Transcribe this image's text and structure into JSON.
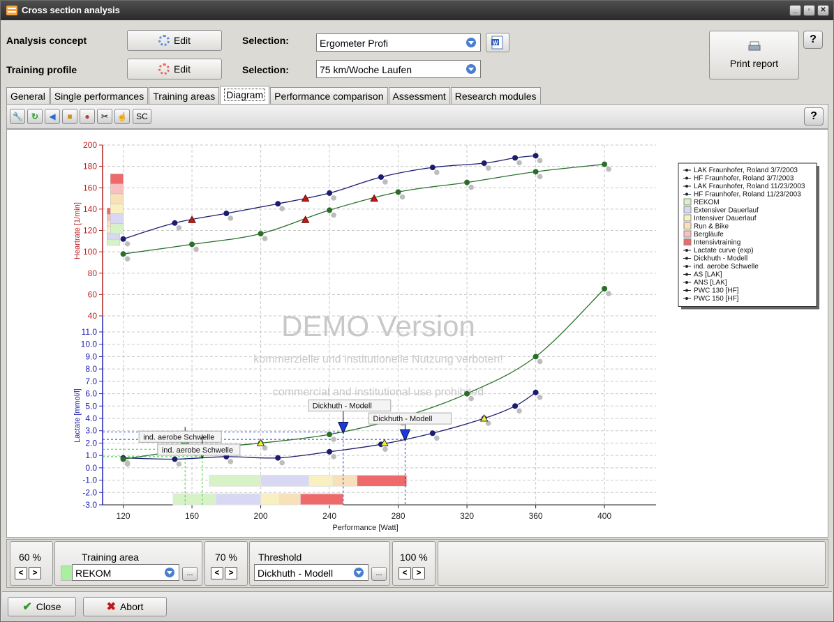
{
  "window": {
    "title": "Cross section analysis"
  },
  "header": {
    "analysis_concept_label": "Analysis concept",
    "training_profile_label": "Training profile",
    "edit_label": "Edit",
    "selection_label": "Selection:",
    "analysis_selection": "Ergometer Profi",
    "training_selection": "75 km/Woche Laufen",
    "print_label": "Print report",
    "help_label": "?"
  },
  "tabs": [
    {
      "label": "General"
    },
    {
      "label": "Single performances"
    },
    {
      "label": "Training areas"
    },
    {
      "label": "Diagram"
    },
    {
      "label": "Performance comparison"
    },
    {
      "label": "Assessment"
    },
    {
      "label": "Research modules"
    }
  ],
  "toolbar": {
    "sc_label": "SC",
    "help_label": "?"
  },
  "chart_data": {
    "type": "line",
    "xlabel": "Performance [Watt]",
    "ylabel_top": "Heartrate [1/min]",
    "ylabel_bottom": "Lactate [mmol/l]",
    "x_ticks": [
      120,
      160,
      200,
      240,
      280,
      320,
      360,
      400
    ],
    "hr_ticks": [
      40,
      60,
      80,
      100,
      120,
      140,
      160,
      180,
      200
    ],
    "lac_ticks": [
      "11.0",
      "10.0",
      "9.0",
      "8.0",
      "7.0",
      "6.0",
      "5.0",
      "4.0",
      "3.0",
      "2.0",
      "1.0",
      "0.0",
      "-1.0",
      "-2.0",
      "-3.0"
    ],
    "xlim": [
      108,
      430
    ],
    "hr_lim": [
      40,
      200
    ],
    "lac_lim": [
      -3,
      11
    ],
    "grid": true,
    "legend_position": "right",
    "watermark": {
      "title": "DEMO Version",
      "line1": "kommerzielle und institutionelle Nutzung verboten!",
      "line2": "commercial and institutional use prohibited"
    },
    "legend": [
      "LAK Fraunhofer, Roland 3/7/2003",
      "HF Fraunhofer, Roland 3/7/2003",
      "LAK Fraunhofer, Roland 11/23/2003",
      "HF Fraunhofer, Roland 11/23/2003",
      "REKOM",
      "Extensiver Dauerlauf",
      "Intensiver Dauerlauf",
      "Run & Bike",
      "Bergläufe",
      "Intensivtraining",
      "Lactate curve (exp)",
      "Dickhuth - Modell",
      "ind. aerobe Schwelle",
      "AS [LAK]",
      "ANS [LAK]",
      "PWC 130 [HF]",
      "PWC 150 [HF]"
    ],
    "series": [
      {
        "name": "HF Fraunhofer, Roland 3/7/2003",
        "axis": "hr",
        "color": "#1c1c6e",
        "x": [
          120,
          150,
          180,
          210,
          240,
          270,
          300,
          330,
          348,
          360
        ],
        "y": [
          112,
          127,
          136,
          145,
          155,
          170,
          179,
          183,
          188,
          190
        ]
      },
      {
        "name": "HF Fraunhofer, Roland 11/23/2003",
        "axis": "hr",
        "color": "#2a6e2a",
        "x": [
          120,
          160,
          200,
          240,
          280,
          320,
          360,
          400
        ],
        "y": [
          98,
          107,
          117,
          139,
          156,
          165,
          175,
          182
        ]
      },
      {
        "name": "LAK Fraunhofer, Roland 3/7/2003",
        "axis": "lac",
        "color": "#1c1c6e",
        "x": [
          120,
          150,
          180,
          210,
          240,
          270,
          300,
          330,
          348,
          360
        ],
        "y": [
          0.8,
          0.7,
          0.9,
          0.8,
          1.3,
          1.9,
          2.8,
          4.0,
          5.0,
          6.1
        ]
      },
      {
        "name": "LAK Fraunhofer, Roland 11/23/2003",
        "axis": "lac",
        "color": "#2a6e2a",
        "x": [
          120,
          160,
          200,
          240,
          280,
          320,
          360,
          400
        ],
        "y": [
          0.7,
          1.5,
          2.0,
          2.7,
          4.0,
          6.0,
          9.0,
          14.5
        ]
      }
    ],
    "pwc_markers": [
      {
        "x": 160,
        "y": 130
      },
      {
        "x": 226,
        "y": 150
      },
      {
        "x": 226,
        "y": 130
      },
      {
        "x": 266,
        "y": 150
      }
    ],
    "as_markers": [
      {
        "x": 200,
        "y": 2.0
      },
      {
        "x": 272,
        "y": 2.0
      },
      {
        "x": 280,
        "y": 4.0
      },
      {
        "x": 330,
        "y": 4.0
      }
    ],
    "thresholds": [
      {
        "label": "Dickhuth - Modell",
        "x": 248,
        "y": 2.9,
        "color": "#1a3ae0"
      },
      {
        "label": "Dickhuth - Modell",
        "x": 284,
        "y": 2.3,
        "color": "#1a3ae0"
      },
      {
        "label": "ind. aerobe Schwelle",
        "x": 156,
        "y": 1.5,
        "color": "#2ad02a"
      },
      {
        "label": "ind. aerobe Schwelle",
        "x": 166,
        "y": 0.9,
        "color": "#2ad02a"
      }
    ],
    "zone_bars": [
      {
        "lac": -1.5,
        "segments": [
          {
            "from": 170,
            "to": 200,
            "color": "#d8f2c8"
          },
          {
            "from": 200,
            "to": 228,
            "color": "#d8d8f4"
          },
          {
            "from": 228,
            "to": 242,
            "color": "#f8f0c0"
          },
          {
            "from": 242,
            "to": 256,
            "color": "#f8e0b8"
          },
          {
            "from": 256,
            "to": 285,
            "color": "#ee6a6a"
          }
        ]
      },
      {
        "lac": -3.0,
        "segments": [
          {
            "from": 149,
            "to": 174,
            "color": "#d8f2c8"
          },
          {
            "from": 174,
            "to": 200,
            "color": "#d8d8f4"
          },
          {
            "from": 200,
            "to": 211,
            "color": "#f8f0c0"
          },
          {
            "from": 211,
            "to": 223,
            "color": "#f8e0b8"
          },
          {
            "from": 223,
            "to": 248,
            "color": "#ee6a6a"
          }
        ]
      }
    ]
  },
  "bottom": {
    "pct1": "60 %",
    "training_area_label": "Training area",
    "training_area_value": "REKOM",
    "pct2": "70 %",
    "threshold_label": "Threshold",
    "threshold_value": "Dickhuth - Modell",
    "pct3": "100 %",
    "prev": "<",
    "next": ">",
    "more": "..."
  },
  "footer": {
    "close_label": "Close",
    "abort_label": "Abort"
  }
}
